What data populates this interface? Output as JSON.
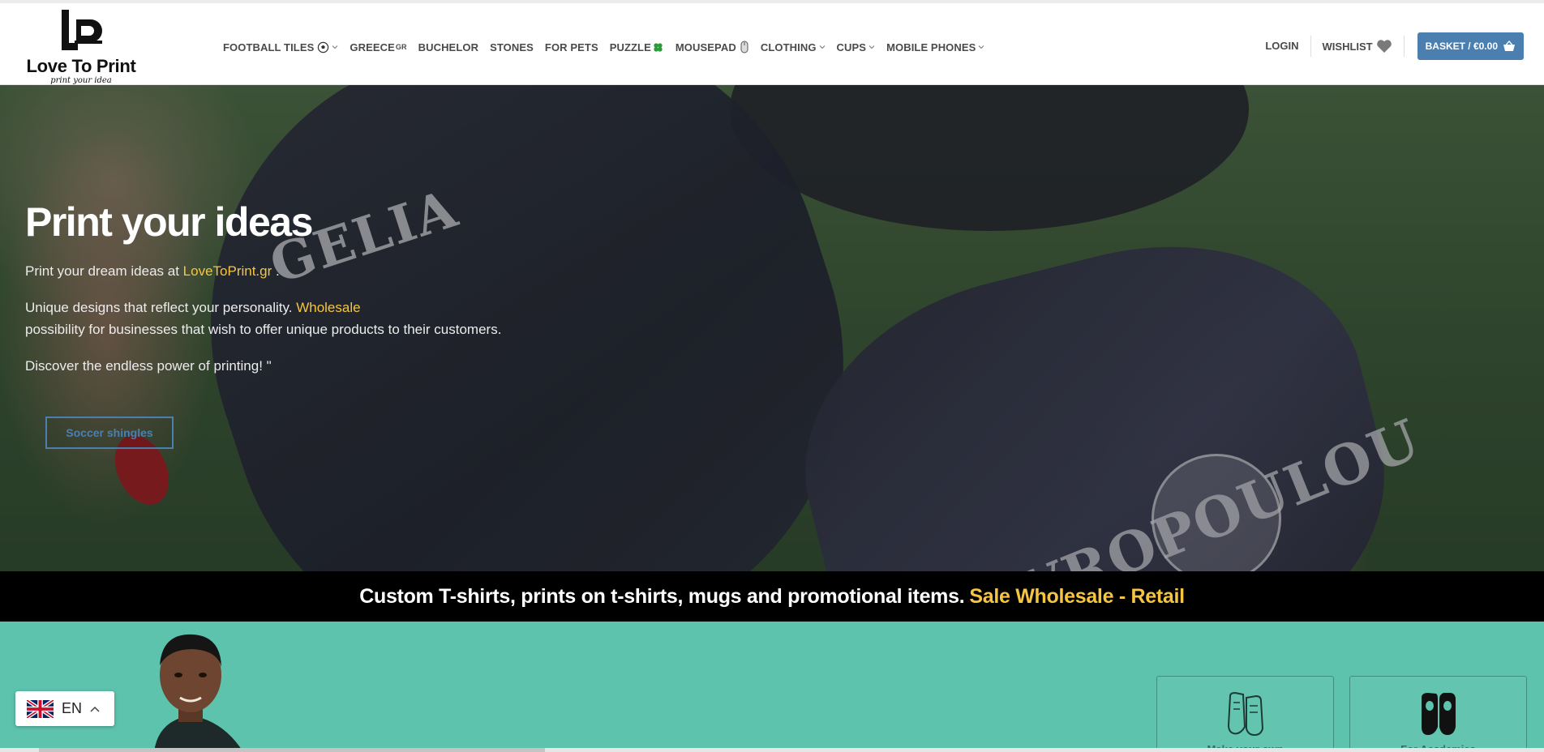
{
  "header": {
    "logo_text": "Love To Print",
    "logo_tagline": "print your idea",
    "nav": [
      {
        "label": "FOOTBALL  TILES",
        "icon": "soccer-ball-icon",
        "dropdown": true
      },
      {
        "label": "GREECE",
        "suffix": "GR",
        "dropdown": false
      },
      {
        "label": "BUCHELOR",
        "dropdown": false
      },
      {
        "label": "STONES",
        "dropdown": false
      },
      {
        "label": "FOR  PETS",
        "dropdown": false
      },
      {
        "label": "PUZZLE",
        "icon": "clover-icon",
        "dropdown": false
      },
      {
        "label": "MOUSEPAD",
        "icon": "mouse-icon",
        "dropdown": false
      },
      {
        "label": "CLOTHING",
        "dropdown": true
      },
      {
        "label": "CUPS",
        "dropdown": true
      },
      {
        "label": "MOBILE  PHONES",
        "dropdown": true
      }
    ],
    "login": "LOGIN",
    "wishlist": "WISHLIST",
    "basket": "BASKET / €0.00"
  },
  "hero": {
    "title": "Print your ideas",
    "p1_pre": "Print your dream ideas at ",
    "p1_link": "LoveToPrint.gr",
    "p1_post": " .",
    "p2_pre": "Unique designs that reflect your personality. ",
    "p2_link": "Wholesale",
    "p2_post": "possibility for businesses that wish to offer unique products to their customers.",
    "p3": "Discover the endless power of printing! \"",
    "button": "Soccer shingles",
    "bg_text_1": "GELIA",
    "bg_text_2": "STAVROPOULOU"
  },
  "band": {
    "text": "Custom T-shirts, prints on t-shirts, mugs and promotional items.",
    "highlight": "Sale Wholesale - Retail"
  },
  "cards": [
    {
      "label": "Make your own",
      "icon": "shin-guard-outline-icon"
    },
    {
      "label": "For Academies",
      "icon": "shin-guard-filled-icon"
    }
  ],
  "language": {
    "code": "EN",
    "flag": "uk-flag-icon"
  },
  "colors": {
    "accent": "#4a7fb0",
    "highlight": "#f5c542",
    "teal": "#5dc3ad",
    "band": "#000000"
  }
}
